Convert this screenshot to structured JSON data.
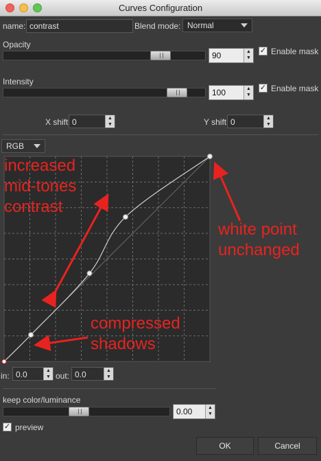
{
  "window": {
    "title": "Curves Configuration"
  },
  "top": {
    "name_label": "name:",
    "name_value": "contrast",
    "blend_label": "Blend mode:",
    "blend_value": "Normal"
  },
  "opacity": {
    "label": "Opacity",
    "value": "90",
    "enable_mask_label": "Enable mask",
    "level": 0.9
  },
  "intensity": {
    "label": "Intensity",
    "value": "100",
    "enable_mask_label": "Enable mask",
    "level": 1.0
  },
  "shift": {
    "x_label": "X shift",
    "x_value": "0",
    "y_label": "Y shift",
    "y_value": "0"
  },
  "channel": {
    "value": "RGB"
  },
  "curve": {
    "in_label": "in:",
    "in_value": "0.0",
    "out_label": "out:",
    "out_value": "0.0"
  },
  "annotations": {
    "a1": "increased",
    "a2": "mid-tones",
    "a3": "contrast",
    "b1": "white point",
    "b2": "unchanged",
    "c1": "compressed",
    "c2": "shadows"
  },
  "keep": {
    "label": "keep color/luminance",
    "value": "0.00",
    "level": 0.5
  },
  "preview": {
    "label": "preview",
    "checked": true
  },
  "buttons": {
    "ok": "OK",
    "cancel": "Cancel"
  },
  "colors": {
    "annotation": "#e8231f",
    "background": "#3b3b3b"
  }
}
